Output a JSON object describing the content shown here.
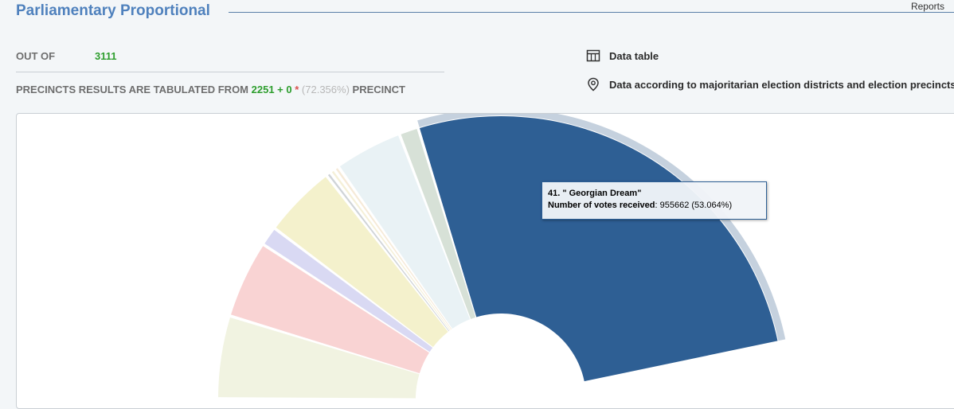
{
  "header": {
    "title": "Parliamentary Proportional",
    "reports_label": "Reports"
  },
  "stats": {
    "out_of_label": "OUT OF",
    "out_of_value": "3111",
    "precincts_prefix": "PRECINCTS RESULTS ARE TABULATED FROM",
    "tabulated": "2251 + 0",
    "star": "*",
    "percent": "(72.356%)",
    "precinct_suffix": "PRECINCT"
  },
  "links": {
    "data_table": "Data table",
    "districts": "Data according to majoritarian election districts and election precincts"
  },
  "icons": {
    "data_table": "table-icon",
    "districts": "location-pin-icon"
  },
  "tooltip": {
    "title": "41. \" Georgian Dream\"",
    "votes_label": "Number of votes received",
    "votes_value": ": 955662 (53.064%)"
  },
  "chart_data": {
    "type": "pie",
    "variant": "semi-donut",
    "note_visible": "Only the upper-left half of the semi-donut is visible; remaining slices are cut off by the frame.",
    "visible_slices": [
      {
        "color": "#f1f3e1",
        "angle_deg": 17.0
      },
      {
        "color": "#f9d3d3",
        "angle_deg": 16.0
      },
      {
        "color": "#d9d9f3",
        "angle_deg": 4.0
      },
      {
        "color": "#f4f1cc",
        "angle_deg": 15.0
      },
      {
        "color": "#d0d4d8",
        "angle_deg": 1.0
      },
      {
        "color": "#f5f0d8",
        "angle_deg": 1.0
      },
      {
        "color": "#f6ead8",
        "angle_deg": 1.0
      },
      {
        "color": "#e9f2f5",
        "angle_deg": 14.0
      },
      {
        "color": "#d7e1d7",
        "angle_deg": 4.0
      },
      {
        "name": "41. \" Georgian Dream\"",
        "votes": 955662,
        "percent": 53.064,
        "color": "#2e5f94",
        "angle_deg": 95.5,
        "selected": true
      }
    ],
    "hover_ring_color": "#c5d1de"
  }
}
